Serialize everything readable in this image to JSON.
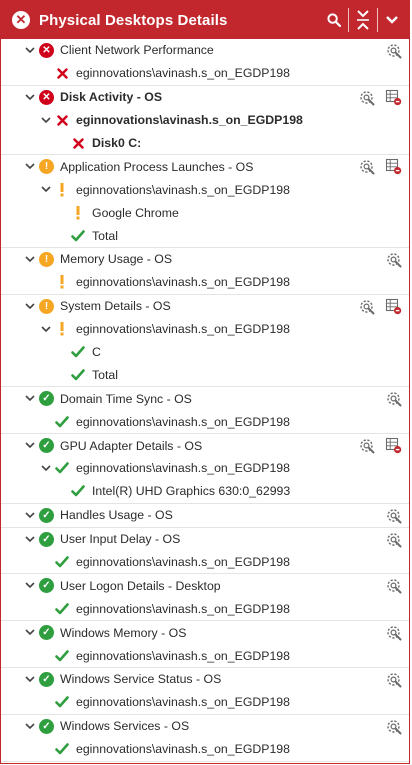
{
  "header": {
    "title": "Physical Desktops Details"
  },
  "colors": {
    "brand": "#c1272d",
    "error": "#d0021b",
    "warning": "#f5a623",
    "ok": "#2e9e3f"
  },
  "rows": [
    {
      "level": 0,
      "status": "err",
      "label": "Client Network Performance",
      "tools": [
        "wrench"
      ]
    },
    {
      "level": 1,
      "status": "err",
      "label": "eginnovations\\avinash.s_on_EGDP198",
      "tools": []
    },
    {
      "level": 0,
      "status": "err",
      "label": "Disk Activity - OS",
      "bold": true,
      "tools": [
        "wrench",
        "grid"
      ]
    },
    {
      "level": 1,
      "status": "err",
      "label": "eginnovations\\avinash.s_on_EGDP198",
      "bold": true,
      "expander": true,
      "tools": []
    },
    {
      "level": 2,
      "status": "err",
      "label": "Disk0 C:",
      "bold": true,
      "tools": []
    },
    {
      "level": 0,
      "status": "warn",
      "label": "Application Process Launches - OS",
      "tools": [
        "wrench",
        "grid"
      ]
    },
    {
      "level": 1,
      "status": "warn",
      "label": "eginnovations\\avinash.s_on_EGDP198",
      "expander": true,
      "tools": []
    },
    {
      "level": 2,
      "status": "warn",
      "label": "Google Chrome",
      "tools": []
    },
    {
      "level": 2,
      "status": "ok",
      "label": "Total",
      "tools": []
    },
    {
      "level": 0,
      "status": "warn",
      "label": "Memory Usage - OS",
      "tools": [
        "wrench"
      ]
    },
    {
      "level": 1,
      "status": "warn",
      "label": "eginnovations\\avinash.s_on_EGDP198",
      "tools": []
    },
    {
      "level": 0,
      "status": "warn",
      "label": "System Details - OS",
      "tools": [
        "wrench",
        "grid"
      ]
    },
    {
      "level": 1,
      "status": "warn",
      "label": "eginnovations\\avinash.s_on_EGDP198",
      "expander": true,
      "tools": []
    },
    {
      "level": 2,
      "status": "ok",
      "label": "C",
      "tools": []
    },
    {
      "level": 2,
      "status": "ok",
      "label": "Total",
      "tools": []
    },
    {
      "level": 0,
      "status": "ok",
      "label": "Domain Time Sync - OS",
      "tools": [
        "wrench"
      ]
    },
    {
      "level": 1,
      "status": "ok",
      "label": "eginnovations\\avinash.s_on_EGDP198",
      "tools": []
    },
    {
      "level": 0,
      "status": "ok",
      "label": "GPU Adapter Details - OS",
      "tools": [
        "wrench",
        "grid"
      ]
    },
    {
      "level": 1,
      "status": "ok",
      "label": "eginnovations\\avinash.s_on_EGDP198",
      "expander": true,
      "tools": []
    },
    {
      "level": 2,
      "status": "ok",
      "label": "Intel(R) UHD Graphics 630:0_62993",
      "tools": []
    },
    {
      "level": 0,
      "status": "ok",
      "label": "Handles Usage - OS",
      "tools": [
        "wrench"
      ]
    },
    {
      "level": 0,
      "status": "ok",
      "label": "User Input Delay - OS",
      "tools": [
        "wrench"
      ]
    },
    {
      "level": 1,
      "status": "ok",
      "label": "eginnovations\\avinash.s_on_EGDP198",
      "tools": []
    },
    {
      "level": 0,
      "status": "ok",
      "label": "User Logon Details - Desktop",
      "tools": [
        "wrench"
      ]
    },
    {
      "level": 1,
      "status": "ok",
      "label": "eginnovations\\avinash.s_on_EGDP198",
      "tools": []
    },
    {
      "level": 0,
      "status": "ok",
      "label": "Windows Memory - OS",
      "tools": [
        "wrench"
      ]
    },
    {
      "level": 1,
      "status": "ok",
      "label": "eginnovations\\avinash.s_on_EGDP198",
      "tools": []
    },
    {
      "level": 0,
      "status": "ok",
      "label": "Windows Service Status - OS",
      "tools": [
        "wrench"
      ]
    },
    {
      "level": 1,
      "status": "ok",
      "label": "eginnovations\\avinash.s_on_EGDP198",
      "tools": []
    },
    {
      "level": 0,
      "status": "ok",
      "label": "Windows Services - OS",
      "tools": [
        "wrench"
      ]
    },
    {
      "level": 1,
      "status": "ok",
      "label": "eginnovations\\avinash.s_on_EGDP198",
      "tools": []
    }
  ]
}
